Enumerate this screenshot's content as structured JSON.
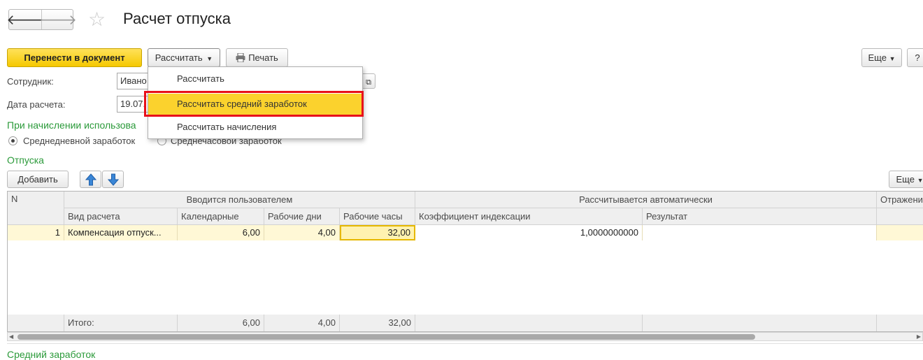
{
  "header": {
    "title": "Расчет отпуска"
  },
  "toolbar": {
    "transfer_label": "Перенести в документ",
    "calculate_label": "Рассчитать",
    "print_label": "Печать",
    "more_label": "Еще",
    "help_label": "?"
  },
  "dropdown": {
    "items": [
      {
        "label": "Рассчитать"
      },
      {
        "label": "Рассчитать средний заработок"
      },
      {
        "label": "Рассчитать начисления"
      }
    ]
  },
  "form": {
    "employee_label": "Сотрудник:",
    "employee_value": "Ивано",
    "date_label": "Дата расчета:",
    "date_value": "19.07.",
    "accrual_group_label": "При начислении использова",
    "radio_daily": "Среднедневной заработок",
    "radio_hourly": "Среднечасовой заработок"
  },
  "vacations": {
    "section_label": "Отпуска",
    "add_label": "Добавить",
    "more_label": "Еще"
  },
  "table": {
    "col_n": "N",
    "group_user": "Вводится пользователем",
    "group_auto": "Рассчитывается автоматически",
    "group_reflect": "Отражени",
    "columns": {
      "type": "Вид расчета",
      "calendar": "Календарные",
      "workdays": "Рабочие дни",
      "workhours": "Рабочие часы",
      "index_coef": "Коэффициент индексации",
      "result": "Результат"
    },
    "rows": [
      {
        "n": "1",
        "type": "Компенсация отпуск...",
        "calendar": "6,00",
        "workdays": "4,00",
        "workhours": "32,00",
        "index_coef": "1,0000000000",
        "result": ""
      }
    ],
    "footer": {
      "label": "Итого:",
      "calendar": "6,00",
      "workdays": "4,00",
      "workhours": "32,00"
    }
  },
  "bottom": {
    "section_label": "Средний заработок"
  },
  "colors": {
    "accent_yellow": "#f5c800",
    "highlight_red": "#e8101a",
    "section_green": "#2b9a3a",
    "row_selected": "#fff8d6"
  }
}
